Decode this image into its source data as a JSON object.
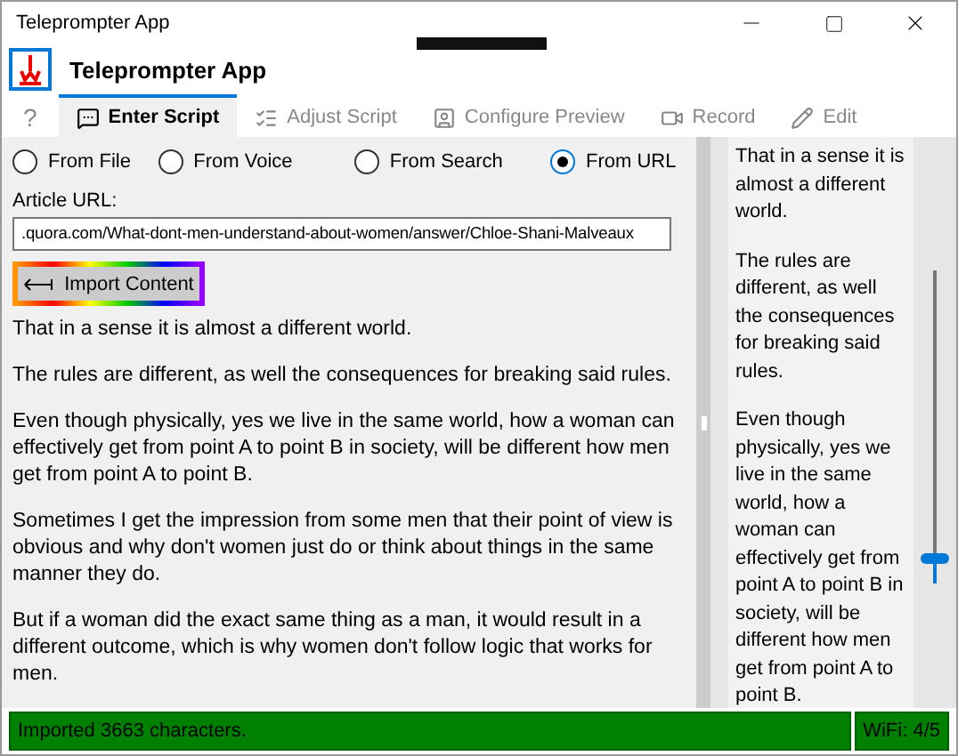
{
  "window": {
    "title": "Teleprompter App"
  },
  "header": {
    "title": "Teleprompter App"
  },
  "tabs": [
    {
      "label": "?",
      "kind": "help",
      "selected": false
    },
    {
      "label": "Enter Script",
      "kind": "chat",
      "selected": true
    },
    {
      "label": "Adjust Script",
      "kind": "list",
      "selected": false
    },
    {
      "label": "Configure Preview",
      "kind": "portrait",
      "selected": false
    },
    {
      "label": "Record",
      "kind": "camera",
      "selected": false
    },
    {
      "label": "Edit",
      "kind": "pencil",
      "selected": false
    }
  ],
  "sources": [
    {
      "label": "From File",
      "selected": false
    },
    {
      "label": "From Voice",
      "selected": false
    },
    {
      "label": "From Search",
      "selected": false
    },
    {
      "label": "From URL",
      "selected": true
    }
  ],
  "url_field": {
    "label": "Article URL:",
    "value": ".quora.com/What-dont-men-understand-about-women/answer/Chloe-Shani-Malveaux"
  },
  "import_button": {
    "label": "Import Content"
  },
  "script_paragraphs": [
    "That in a sense it is almost a different world.",
    "The rules are different, as well the consequences for breaking said rules.",
    "Even though physically, yes we live in the same world, how a woman can effectively get from point A to point B in society, will be different how men get from point A to point B.",
    "Sometimes I get the impression from some men that their point of view is obvious and why don't women just do or think about things in the same manner they do.",
    "But if a woman did the exact same thing as a man, it would result in a different outcome, which is why women don't follow logic that works for men."
  ],
  "preview_paragraphs": [
    "That in a sense it is almost a different world.",
    "The rules are different, as well the consequences for breaking said rules.",
    "Even though physically, yes we live in the same world, how a woman can effectively get from point A to point B in society, will be different how men get from point A to point B."
  ],
  "speed_slider": {
    "level": 0.08
  },
  "status_bar": {
    "message": "Imported 3663 characters.",
    "wifi": "WiFi: 4/5"
  }
}
